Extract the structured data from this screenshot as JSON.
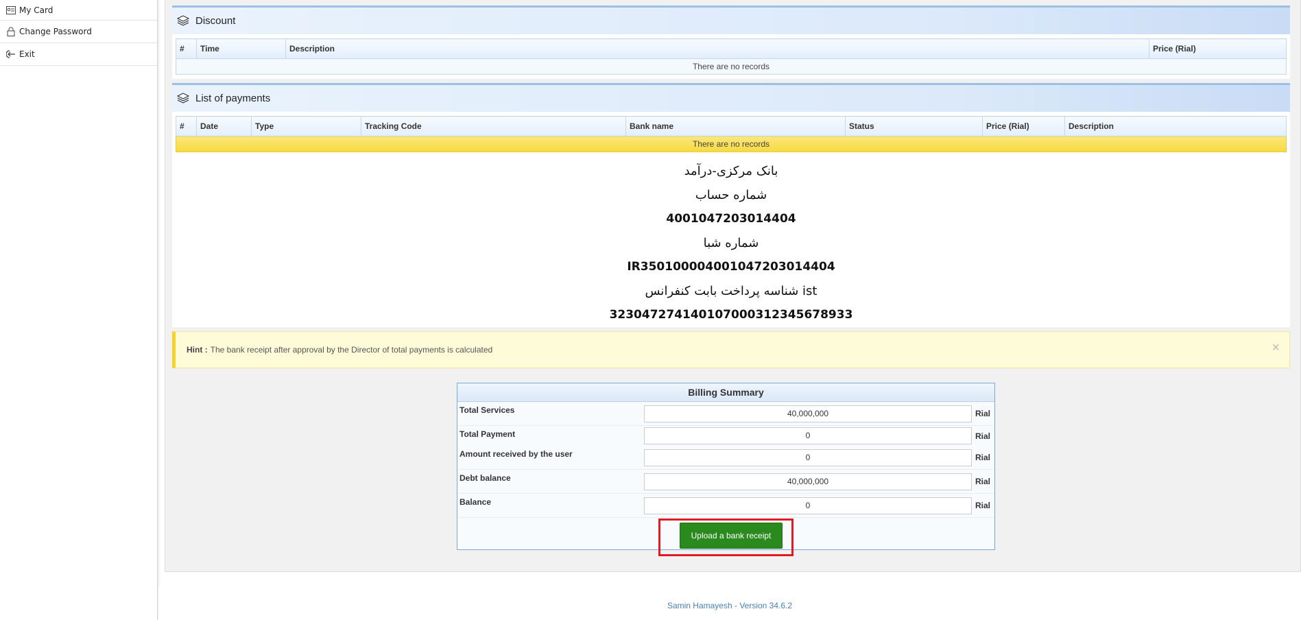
{
  "sidebar": {
    "items": [
      {
        "label": "My Card",
        "icon": "id-card-icon"
      },
      {
        "label": "Change Password",
        "icon": "lock-icon"
      },
      {
        "label": "Exit",
        "icon": "logout-icon"
      }
    ]
  },
  "discount": {
    "title": "Discount",
    "columns": [
      "#",
      "Time",
      "Description",
      "Price (Rial)"
    ],
    "empty_text": "There are no records"
  },
  "payments": {
    "title": "List of payments",
    "columns": [
      "#",
      "Date",
      "Type",
      "Tracking Code",
      "Bank name",
      "Status",
      "Price (Rial)",
      "Description"
    ],
    "empty_text": "There are no records"
  },
  "bank_info": {
    "bank_name": "بانک مرکزی-درآمد",
    "account_label": "شماره حساب",
    "account_number": "4001047203014404",
    "sheba_label": "شماره شبا",
    "sheba_number": "IR350100004001047203014404",
    "payment_id_label": "شناسه پرداخت بابت کنفرانس ist",
    "payment_id": "323047274140107000312345678933"
  },
  "hint": {
    "label": "Hint :",
    "text": "The bank receipt after approval by the Director of total payments is calculated",
    "close": "×"
  },
  "billing": {
    "title": "Billing Summary",
    "unit": "Rial",
    "rows": [
      {
        "label": "Total Services",
        "value": "40,000,000"
      },
      {
        "label": "Total Payment",
        "value": "0"
      },
      {
        "label": "Amount received by the user",
        "value": "0"
      },
      {
        "label": "Debt balance",
        "value": "40,000,000"
      },
      {
        "label": "Balance",
        "value": "0"
      }
    ],
    "upload_button": "Upload a bank receipt"
  },
  "footer": {
    "text": "Samin Hamayesh - Version 34.6.2"
  },
  "colors": {
    "accent_blue": "#9cbfe6",
    "upload_green": "#2a8a1e",
    "highlight_red": "#e01b24",
    "empty_row_yellow": "#f7d940"
  }
}
